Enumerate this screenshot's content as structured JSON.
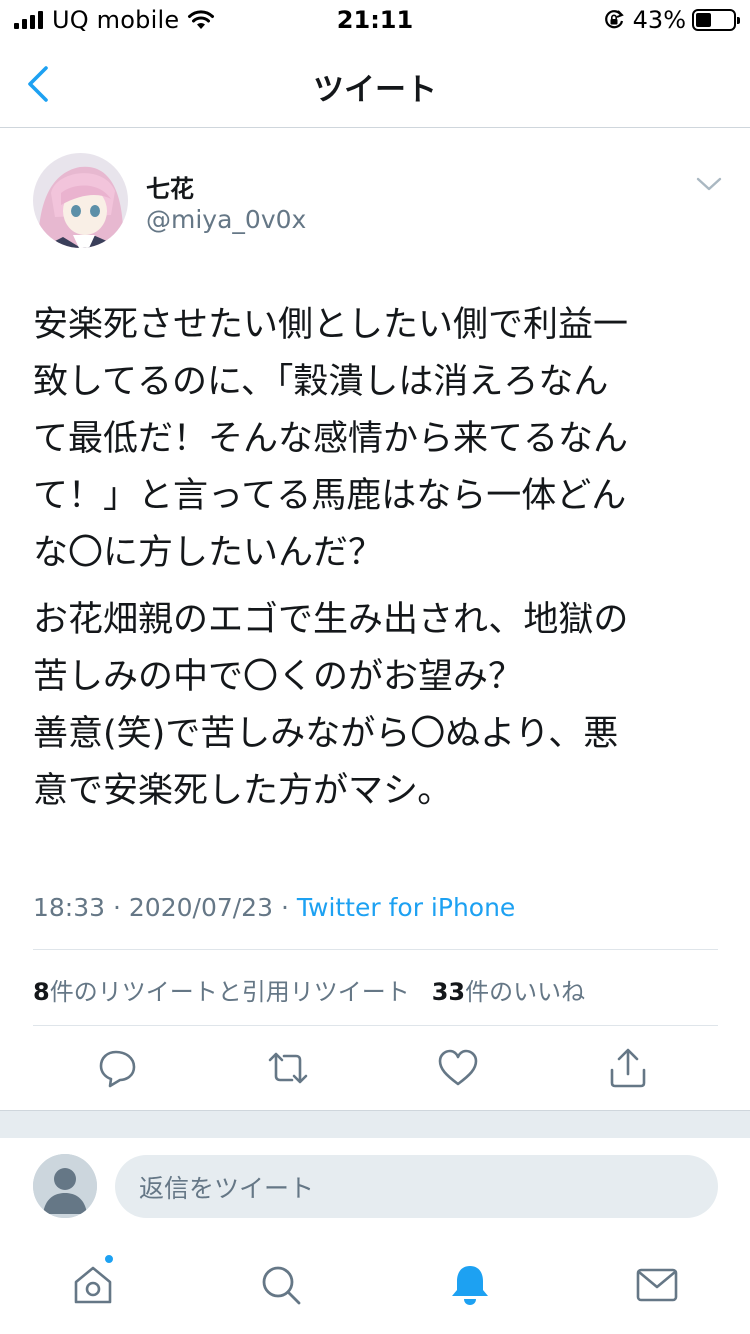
{
  "status_bar": {
    "carrier": "UQ mobile",
    "time": "21:11",
    "battery_percent": "43%",
    "battery_level": 0.43,
    "icons": [
      "signal-icon",
      "wifi-icon",
      "rotation-lock-icon",
      "battery-icon"
    ]
  },
  "nav": {
    "title": "ツイート",
    "back_icon": "chevron-left-icon"
  },
  "tweet": {
    "display_name": "七花",
    "handle": "@miya_0v0x",
    "paragraph_1": "安楽死させたい側としたい側で利益一\n致してるのに、「穀潰しは消えろなん\nて最低だ！そんな感情から来てるなん\nて！」と言ってる馬鹿はなら一体どん\nな〇に方したいんだ？",
    "paragraph_2": "お花畑親のエゴで生み出され、地獄の\n苦しみの中で〇くのがお望み？\n善意(笑)で苦しみながら〇ぬより、悪\n意で安楽死した方がマシ。",
    "time": "18:33",
    "date": "2020/07/23",
    "separator": "·",
    "source": "Twitter for iPhone"
  },
  "stats": {
    "retweets_count": "8",
    "retweets_label": "件のリツイートと引用リツイート",
    "likes_count": "33",
    "likes_label": "件のいいね"
  },
  "actions": [
    "reply-icon",
    "retweet-icon",
    "like-icon",
    "share-icon"
  ],
  "reply": {
    "placeholder": "返信をツイート"
  },
  "tabbar": {
    "items": [
      "home-icon",
      "search-icon",
      "notifications-icon",
      "messages-icon"
    ],
    "active": "notifications-icon"
  },
  "colors": {
    "accent": "#1da1f2",
    "text": "#14171a",
    "secondary": "#657786",
    "icon": "#657786"
  }
}
